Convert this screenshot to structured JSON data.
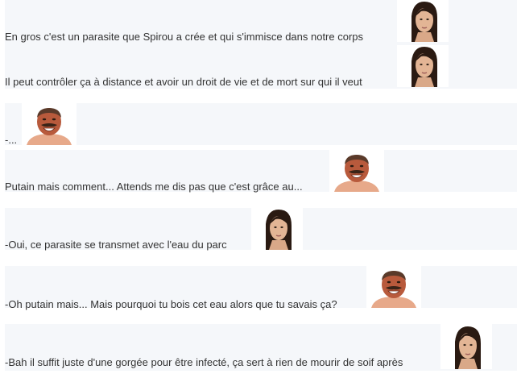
{
  "messages": [
    {
      "text": "En gros c'est un parasite que Spirou a crée et qui s'immisce dans notre corps",
      "sticker": "woman-face-sticker"
    },
    {
      "text": "Il peut contrôler ça à distance et avoir un droit de vie et de mort sur qui il veut",
      "sticker": "woman-face-sticker"
    },
    {
      "text": "-...",
      "sticker": "laughing-man-sticker"
    },
    {
      "text": "Putain mais comment... Attends me dis pas que c'est grâce au...",
      "sticker": "laughing-man-sticker"
    },
    {
      "text": "-Oui, ce parasite se transmet avec l'eau du parc",
      "sticker": "woman-face-sticker"
    },
    {
      "text": "-Oh putain mais... Mais pourquoi tu bois cet eau alors que tu savais ça?",
      "sticker": "laughing-man-sticker"
    },
    {
      "text": "-Bah il suffit juste d'une gorgée pour être infecté, ça sert à rien de mourir de soif après",
      "sticker": "woman-face-sticker"
    }
  ],
  "colors": {
    "block_background": "#f5f7fa",
    "text": "#333333"
  }
}
